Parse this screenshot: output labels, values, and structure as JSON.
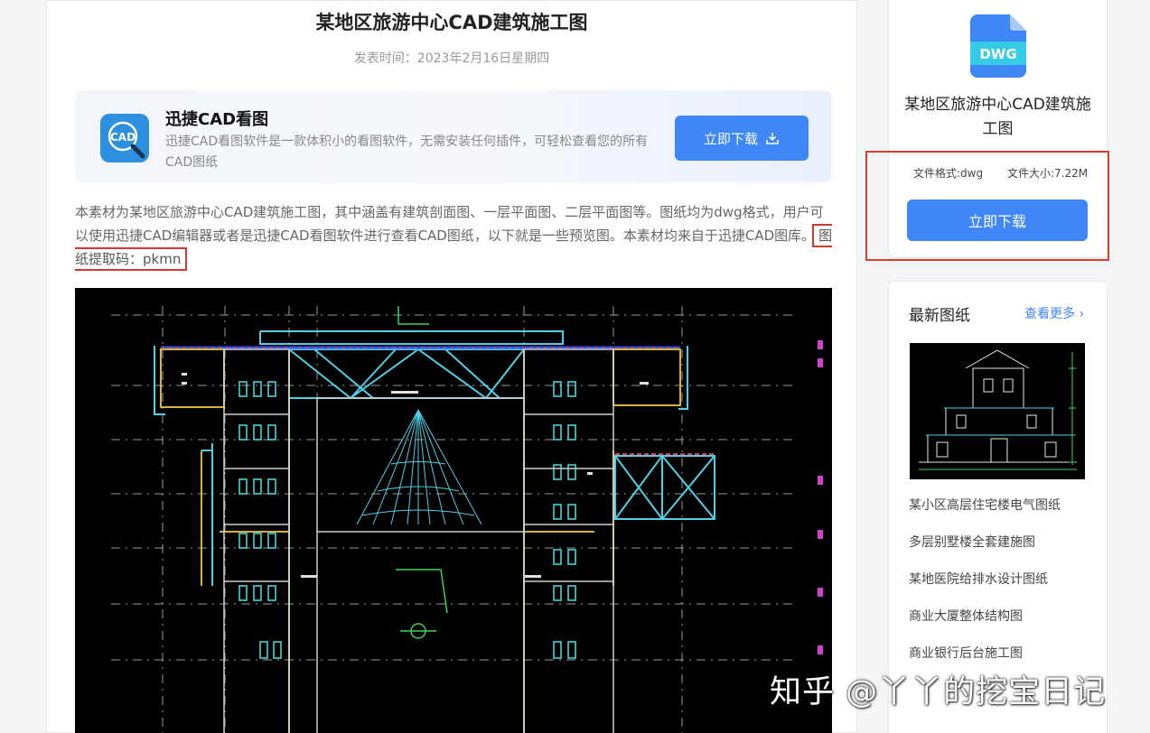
{
  "article": {
    "title": "某地区旅游中心CAD建筑施工图",
    "published": "发表时间：2023年2月16日星期四",
    "promo": {
      "logo_text": "CAD",
      "app_name": "迅捷CAD看图",
      "description": "迅捷CAD看图软件是一款体积小的看图软件，无需安装任何插件，可轻松查看您的所有CAD图纸",
      "download_label": "立即下载"
    },
    "body": "本素材为某地区旅游中心CAD建筑施工图，其中涵盖有建筑剖面图、一层平面图、二层平面图等。图纸均为dwg格式，用户可以使用迅捷CAD编辑器或者是迅捷CAD看图软件进行查看CAD图纸，以下就是一些预览图。本素材均来自于迅捷CAD图库。",
    "extract_code": "图纸提取码：pkmn"
  },
  "sidebar": {
    "file_badge": "DWG",
    "file_title": "某地区旅游中心CAD建筑施工图",
    "format": "文件格式:dwg",
    "size": "文件大小:7.22M",
    "download_label": "立即下载",
    "latest_title": "最新图纸",
    "more_label": "查看更多 ›",
    "latest_items": [
      {
        "label": "某小区高层住宅楼电气图纸"
      },
      {
        "label": "多层别墅楼全套建施图"
      },
      {
        "label": "某地医院给排水设计图纸"
      },
      {
        "label": "商业大厦整体结构图"
      },
      {
        "label": "商业银行后台施工图"
      }
    ]
  },
  "watermark": "知乎 @丫丫的挖宝日记",
  "colors": {
    "accent": "#3f86f7",
    "highlight_red": "#e0392d",
    "cad_background": "#000000"
  }
}
